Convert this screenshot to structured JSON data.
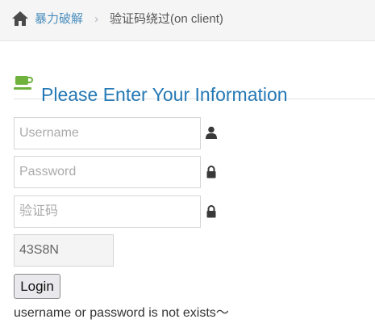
{
  "breadcrumb": {
    "home_label": "暴力破解",
    "separator": "›",
    "current": "验证码绕过(on client)"
  },
  "header": {
    "title": "Please Enter Your Information",
    "icon": "coffee-icon",
    "color": "#2679b5"
  },
  "form": {
    "username_placeholder": "Username",
    "password_placeholder": "Password",
    "captcha_placeholder": "验证码",
    "captcha_code": "43S8N",
    "login_label": "Login"
  },
  "message": "username or password is not exists～",
  "colors": {
    "link": "#4c8fbd",
    "icon_green": "#6fb23e",
    "breadcrumb_bg": "#f5f5f5"
  }
}
